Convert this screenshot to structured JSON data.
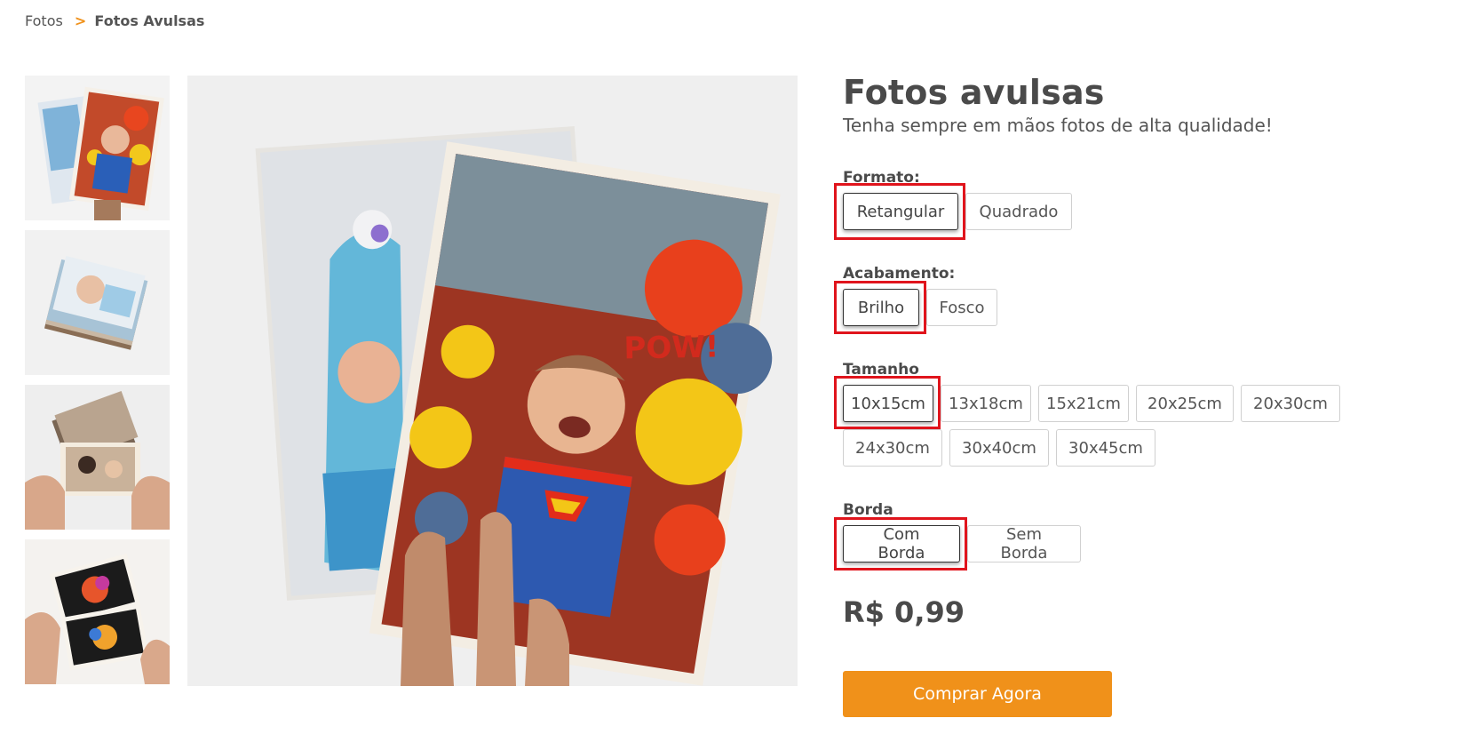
{
  "breadcrumb": {
    "root": "Fotos",
    "separator": ">",
    "current": "Fotos Avulsas"
  },
  "product": {
    "title": "Fotos avulsas",
    "subtitle": "Tenha sempre em mãos fotos de alta qualidade!",
    "price": "R$ 0,99",
    "buy_label": "Comprar Agora"
  },
  "options": {
    "formato": {
      "label": "Formato:",
      "items": [
        "Retangular",
        "Quadrado"
      ],
      "selected": "Retangular"
    },
    "acabamento": {
      "label": "Acabamento:",
      "items": [
        "Brilho",
        "Fosco"
      ],
      "selected": "Brilho"
    },
    "tamanho": {
      "label": "Tamanho",
      "items": [
        "10x15cm",
        "13x18cm",
        "15x21cm",
        "20x25cm",
        "20x30cm",
        "24x30cm",
        "30x40cm",
        "30x45cm"
      ],
      "selected": "10x15cm"
    },
    "borda": {
      "label": "Borda",
      "items": [
        "Com Borda",
        "Sem Borda"
      ],
      "selected": "Com Borda"
    }
  },
  "colors": {
    "accent": "#f0911a",
    "highlight": "#e0141c",
    "text": "#4a4a4a"
  },
  "images": {
    "thumbnails": [
      "stacked-baby-photos",
      "photo-stack",
      "hand-holding-photos",
      "hands-holding-art-photos"
    ],
    "main": "baby-superman-balloons-photo"
  }
}
